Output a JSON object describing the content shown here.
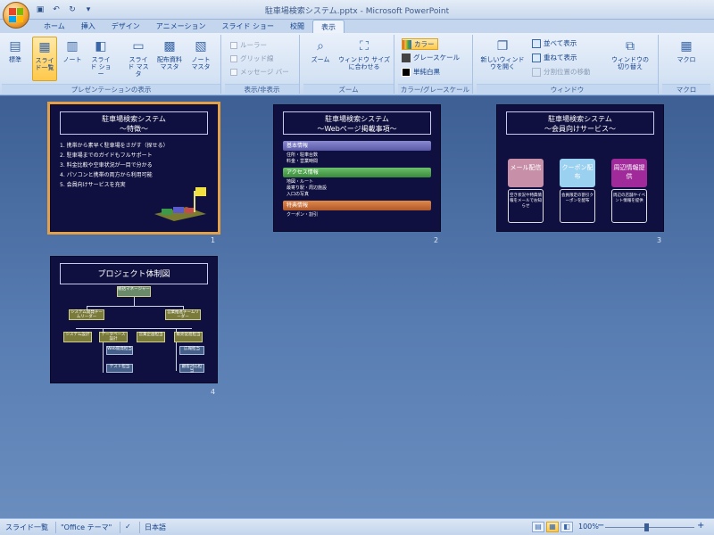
{
  "window": {
    "title": "駐車場検索システム.pptx - Microsoft PowerPoint"
  },
  "qat": {
    "icons": [
      "save-icon",
      "undo-icon",
      "redo-icon",
      "customize-icon"
    ]
  },
  "tabs": [
    {
      "label": "ホーム"
    },
    {
      "label": "挿入"
    },
    {
      "label": "デザイン"
    },
    {
      "label": "アニメーション"
    },
    {
      "label": "スライド ショー"
    },
    {
      "label": "校閲"
    },
    {
      "label": "表示",
      "active": true
    }
  ],
  "ribbon": {
    "groups": {
      "presentation_views": "プレゼンテーションの表示",
      "show_hide": "表示/非表示",
      "zoom": "ズーム",
      "color_gray": "カラー/グレースケール",
      "window": "ウィンドウ",
      "macro": "マクロ"
    },
    "buttons": {
      "normal": "標準",
      "slide_sorter": "スライド一覧",
      "notes_page": "ノート",
      "slide_show": "スライド ショー",
      "slide_master": "スライド マスタ",
      "handout_master": "配布資料 マスタ",
      "notes_master": "ノート マスタ",
      "ruler": "ルーラー",
      "gridlines": "グリッド線",
      "message_bar": "メッセージ バー",
      "zoom": "ズーム",
      "fit_window": "ウィンドウ サイズに合わせる",
      "color": "カラー",
      "grayscale": "グレースケール",
      "pure_bw": "単純白黒",
      "new_window": "新しいウィンドウを開く",
      "arrange_all": "並べて表示",
      "cascade": "重ねて表示",
      "move_split": "分割位置の移動",
      "switch_windows": "ウィンドウの切り替え",
      "macro": "マクロ"
    }
  },
  "slides": [
    {
      "number": "1",
      "title_line1": "駐車場検索システム",
      "title_line2": "～特徴～",
      "bullets": [
        "1. 携帯から素早く駐車場をさがす（探せる）",
        "2. 駐車場までのガイドもフルサポート",
        "3. 料金比較や空車状況が一目で分かる",
        "4. パソコンと携帯の両方から利用可能",
        "5. 会員向けサービスを充実"
      ]
    },
    {
      "number": "2",
      "title_line1": "駐車場検索システム",
      "title_line2": "～Webページ掲載事項～",
      "sections": [
        {
          "label": "基本情報",
          "items": [
            "住所・駐車台数",
            "料金・営業時間"
          ]
        },
        {
          "label": "アクセス情報",
          "items": [
            "地図・ルート",
            "最寄り駅・周辺施設",
            "入口の写真"
          ]
        },
        {
          "label": "特典情報",
          "items": [
            "クーポン・割引"
          ]
        }
      ]
    },
    {
      "number": "3",
      "title_line1": "駐車場検索システム",
      "title_line2": "～会員向けサービス～",
      "cards": [
        {
          "head": "メール配信",
          "body": "空き状況や特典情報をメールでお知らせ"
        },
        {
          "head": "クーポン配布",
          "body": "会員限定の割引クーポンを配布"
        },
        {
          "head": "周辺情報提供",
          "body": "周辺の店舗やイベント情報を提供"
        }
      ]
    },
    {
      "number": "4",
      "title_line1": "プロジェクト体制図",
      "nodes": {
        "top": "統括マネージャー",
        "mid": [
          "システム開発チームリーダー",
          "営業推進チームリーダー"
        ],
        "leaf": [
          "システム設計",
          "データベース設計",
          "営業企画担当",
          "販売促進担当"
        ],
        "sub": [
          "Web開発担当",
          "テスト担当",
          "広報担当",
          "顧客対応担当"
        ]
      }
    }
  ],
  "statusbar": {
    "view": "スライド一覧",
    "theme": "\"Office テーマ\"",
    "language": "日本語",
    "zoom": "100%",
    "zoom_level": 0.5
  }
}
